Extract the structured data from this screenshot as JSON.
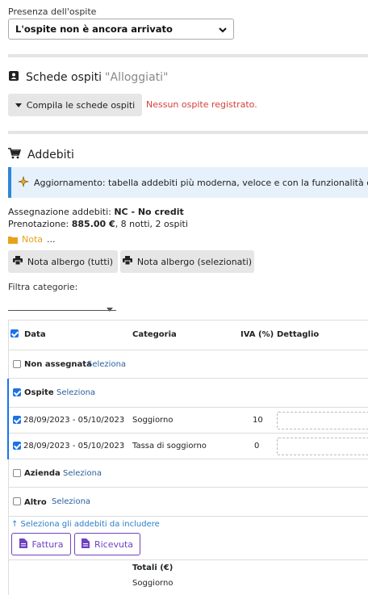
{
  "presence": {
    "label": "Presenza dell'ospite",
    "selected": "L'ospite non è ancora arrivato"
  },
  "guest_cards": {
    "title": "Schede ospiti",
    "subtitle": "\"Alloggiati\"",
    "button": "Compila le schede ospiti",
    "error": "Nessun ospite registrato."
  },
  "charges": {
    "title": "Addebiti",
    "info": "Aggiornamento: tabella addebiti più moderna, veloce e con la funzionalità di esporta",
    "assignment_label": "Assegnazione addebiti:",
    "assignment_value": "NC - No credit",
    "booking_label": "Prenotazione:",
    "booking_amount": "885.00 €",
    "booking_details": ", 8 notti, 2 ospiti",
    "note_label": "Nota",
    "note_more": "...",
    "btn_all": "Nota albergo (tutti)",
    "btn_selected": "Nota albergo (selezionati)",
    "filter_label": "Filtra categorie:"
  },
  "table": {
    "headers": {
      "date": "Data",
      "category": "Categoria",
      "vat": "IVA (%)",
      "detail": "Dettaglio"
    },
    "select_label": "Seleziona",
    "groups": {
      "unassigned": "Non assegnata",
      "guest": "Ospite",
      "company": "Azienda",
      "other": "Altro"
    },
    "rows": [
      {
        "date": "28/09/2023 - 05/10/2023",
        "category": "Soggiorno",
        "vat": "10"
      },
      {
        "date": "28/09/2023 - 05/10/2023",
        "category": "Tassa di soggiorno",
        "vat": "0"
      }
    ],
    "hint": "↑ Seleziona gli addebiti da includere",
    "btn_invoice": "Fattura",
    "btn_receipt": "Ricevuta",
    "totals_label": "Totali (€)",
    "totals_row": "Soggiorno"
  }
}
